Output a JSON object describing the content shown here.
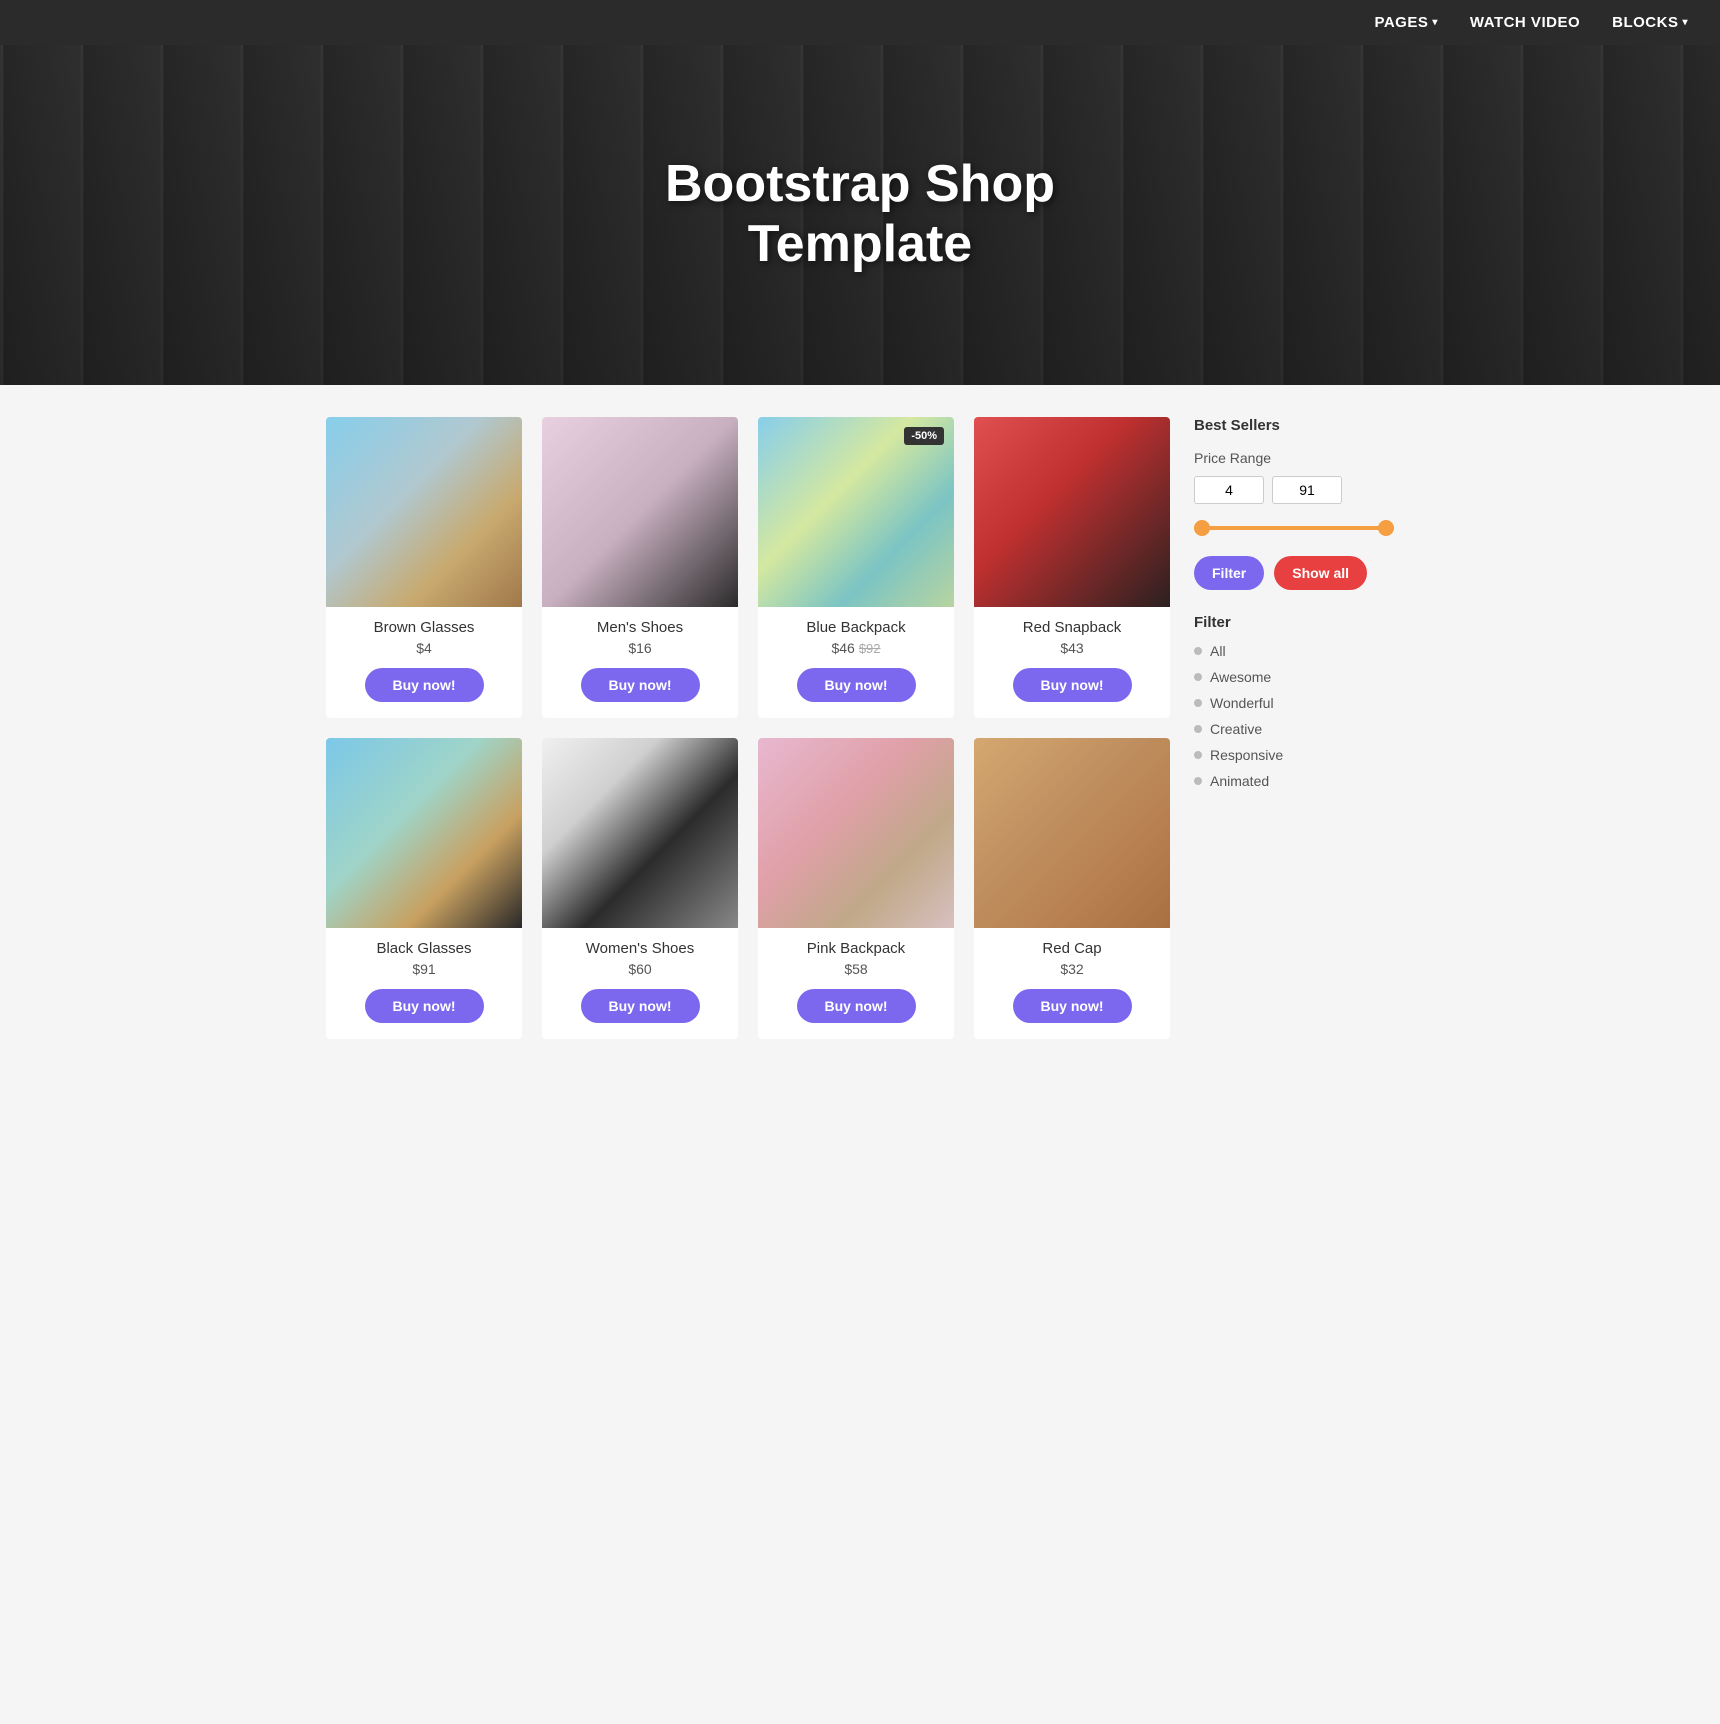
{
  "nav": {
    "items": [
      {
        "label": "PAGES",
        "has_dropdown": true
      },
      {
        "label": "WATCH VIDEO",
        "has_dropdown": false
      },
      {
        "label": "BLOCKS",
        "has_dropdown": true
      }
    ]
  },
  "hero": {
    "title": "Bootstrap Shop Template"
  },
  "products": [
    {
      "id": "brown-glasses",
      "name": "Brown Glasses",
      "price": "$4",
      "price_original": null,
      "discount": null,
      "img_class": "img-brown-glasses",
      "icon": "🕶️"
    },
    {
      "id": "mens-shoes",
      "name": "Men's Shoes",
      "price": "$16",
      "price_original": null,
      "discount": null,
      "img_class": "img-mens-shoes",
      "icon": "👟"
    },
    {
      "id": "blue-backpack",
      "name": "Blue Backpack",
      "price": "$46",
      "price_original": "$92",
      "discount": "-50%",
      "img_class": "img-blue-backpack",
      "icon": "🎒"
    },
    {
      "id": "red-snapback",
      "name": "Red Snapback",
      "price": "$43",
      "price_original": null,
      "discount": null,
      "img_class": "img-red-snapback",
      "icon": "🧢"
    },
    {
      "id": "black-glasses",
      "name": "Black Glasses",
      "price": "$91",
      "price_original": null,
      "discount": null,
      "img_class": "img-black-glasses",
      "icon": "🕶️"
    },
    {
      "id": "womens-shoes",
      "name": "Women's Shoes",
      "price": "$60",
      "price_original": null,
      "discount": null,
      "img_class": "img-womens-shoes",
      "icon": "👟"
    },
    {
      "id": "pink-backpack",
      "name": "Pink Backpack",
      "price": "$58",
      "price_original": null,
      "discount": null,
      "img_class": "img-pink-backpack",
      "icon": "🎒"
    },
    {
      "id": "red-cap",
      "name": "Red Cap",
      "price": "$32",
      "price_original": null,
      "discount": null,
      "img_class": "img-red-cap",
      "icon": "🧢"
    }
  ],
  "sidebar": {
    "best_sellers_label": "Best Sellers",
    "price_range_label": "Price Range",
    "price_min": "4",
    "price_max": "91",
    "filter_button_label": "Filter",
    "show_all_button_label": "Show all",
    "filter_label": "Filter",
    "filter_items": [
      {
        "label": "All"
      },
      {
        "label": "Awesome"
      },
      {
        "label": "Wonderful"
      },
      {
        "label": "Creative"
      },
      {
        "label": "Responsive"
      },
      {
        "label": "Animated"
      }
    ]
  },
  "buy_button_label": "Buy now!"
}
